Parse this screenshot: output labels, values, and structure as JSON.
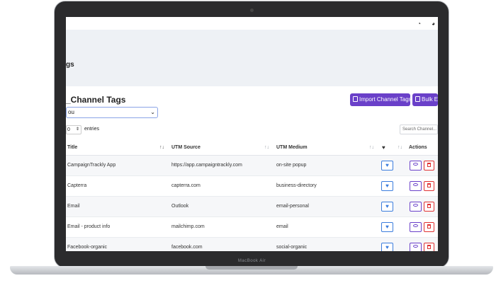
{
  "laptop": {
    "label": "MacBook Air"
  },
  "page": {
    "title": "gs"
  },
  "card": {
    "title": "_Channel Tags",
    "select_value": "ou",
    "import_button": "Import Channel Tags",
    "bulk_button": "Bulk Ex"
  },
  "entries": {
    "value": "0",
    "label": "entries"
  },
  "search": {
    "placeholder": "Search Channel..."
  },
  "table": {
    "headers": {
      "title": "Title",
      "utm_source": "UTM Source",
      "utm_medium": "UTM Medium",
      "actions": "Actions"
    },
    "rows": [
      {
        "title": "CampaignTrackly App",
        "source": "https://app.campaigntrackly.com",
        "medium": "on-site popup"
      },
      {
        "title": "Capterra",
        "source": "capterra.com",
        "medium": "business-directory"
      },
      {
        "title": "Email",
        "source": "Outlook",
        "medium": "email-personal"
      },
      {
        "title": "Email - product info",
        "source": "mailchimp.com",
        "medium": "email"
      },
      {
        "title": "Facebook-organic",
        "source": "facebook.com",
        "medium": "social-organic"
      }
    ]
  },
  "colors": {
    "accent": "#6a40c9",
    "blue": "#3b7ddd",
    "danger": "#e03131"
  },
  "icons": {
    "dashboard": "dashboard-icon",
    "chart": "pie-chart-icon",
    "heart": "heart-icon",
    "view": "eye-icon",
    "delete": "trash-icon"
  }
}
